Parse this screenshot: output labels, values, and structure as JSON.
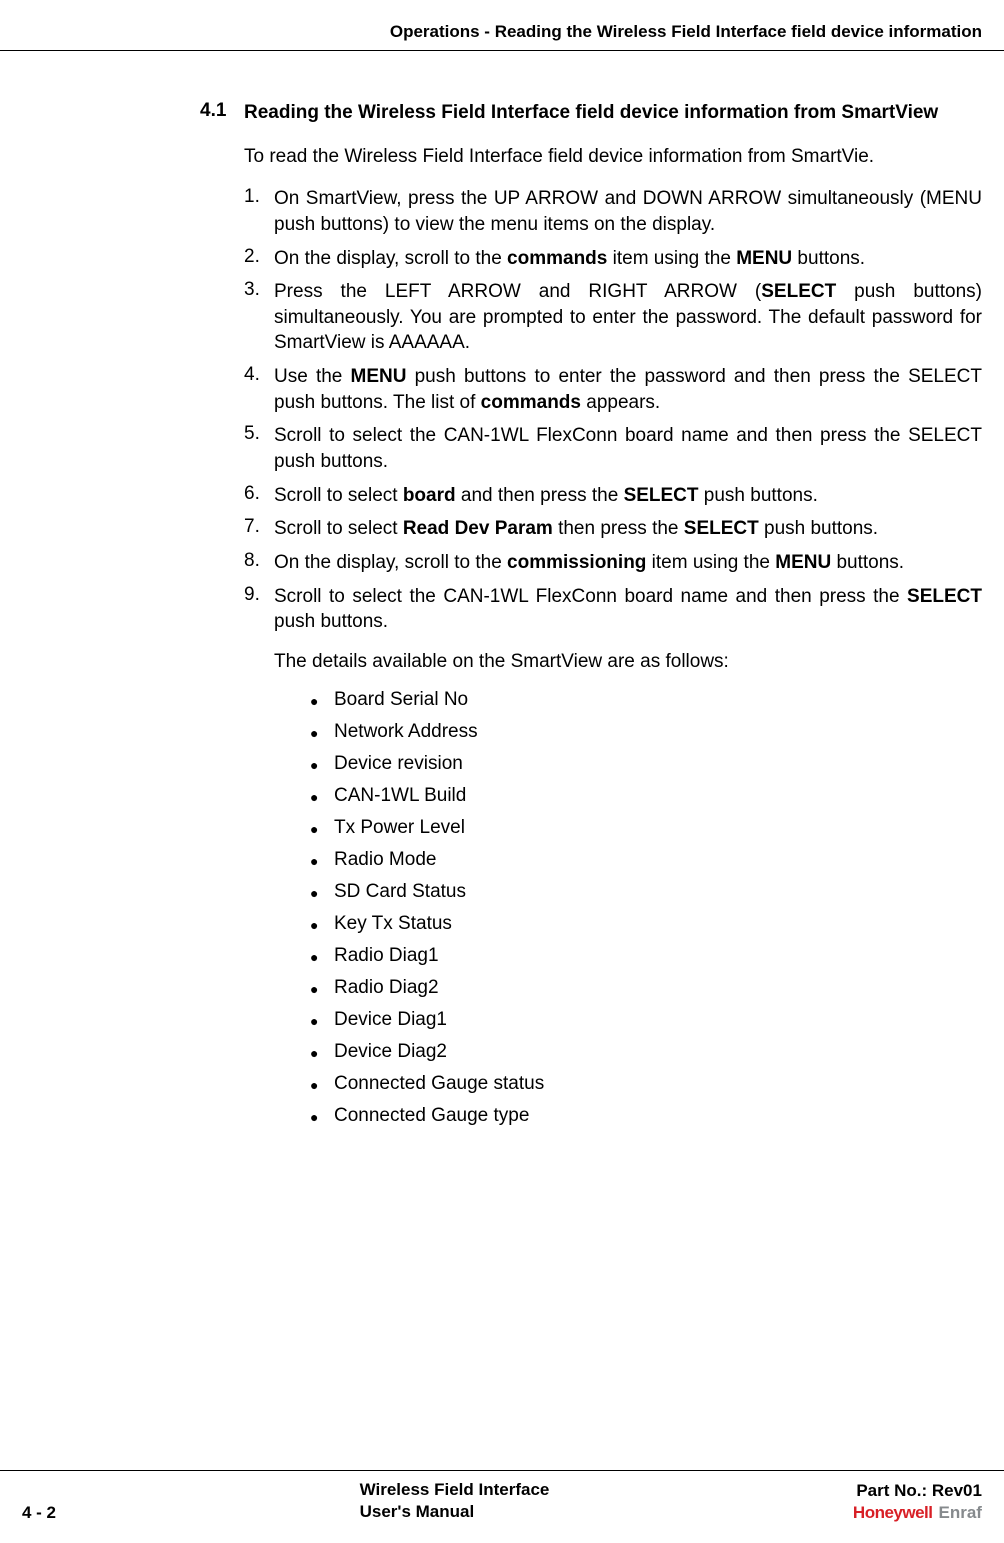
{
  "header": {
    "title": "Operations - Reading the Wireless Field Interface field device information"
  },
  "section": {
    "number": "4.1",
    "title": "Reading the Wireless Field Interface field device information from SmartView"
  },
  "intro": "To read the Wireless Field Interface field device information from SmartVie.",
  "steps": [
    {
      "n": "1.",
      "text": "On SmartView, press the UP ARROW and DOWN ARROW simultaneously (MENU push buttons) to view the menu items on the display."
    },
    {
      "n": "2.",
      "html": "On the display, scroll to the <strong>commands</strong> item using the <strong>MENU</strong> buttons."
    },
    {
      "n": "3.",
      "html": "Press the LEFT ARROW and RIGHT ARROW (<strong>SELECT</strong> push buttons) simultaneously. You are prompted to enter the password. The default password for SmartView is AAAAAA."
    },
    {
      "n": "4.",
      "html": "Use the <strong>MENU</strong> push buttons to enter the password and then press the SELECT push buttons. The list of <strong>commands</strong> appears."
    },
    {
      "n": "5.",
      "text": "Scroll to select the CAN-1WL FlexConn board name and then press the SELECT push buttons."
    },
    {
      "n": "6.",
      "html": "Scroll to select <strong>board</strong> and then press the <strong>SELECT</strong> push buttons."
    },
    {
      "n": "7.",
      "html": "Scroll to select <strong>Read Dev Param</strong> then press the <strong>SELECT</strong> push buttons."
    },
    {
      "n": "8.",
      "html": "On the display, scroll to the <strong>commissioning</strong> item using the <strong>MENU</strong> buttons."
    },
    {
      "n": "9.",
      "html": "Scroll to select the CAN-1WL FlexConn board name and then press the <strong>SELECT</strong> push buttons."
    }
  ],
  "details_text": "The details available on the SmartView are as follows:",
  "bullets": [
    "Board Serial No",
    "Network Address",
    "Device revision",
    "CAN-1WL Build",
    "Tx Power Level",
    "Radio Mode",
    "SD Card Status",
    "Key Tx Status",
    "Radio Diag1",
    "Radio Diag2",
    "Device Diag1",
    "Device Diag2",
    "Connected Gauge status",
    "Connected Gauge type"
  ],
  "footer": {
    "page": "4 - 2",
    "doc_line1": "Wireless Field Interface",
    "doc_line2": "User's Manual",
    "part_no": "Part No.: Rev01",
    "logo1": "Honeywell",
    "logo2": "Enraf"
  }
}
